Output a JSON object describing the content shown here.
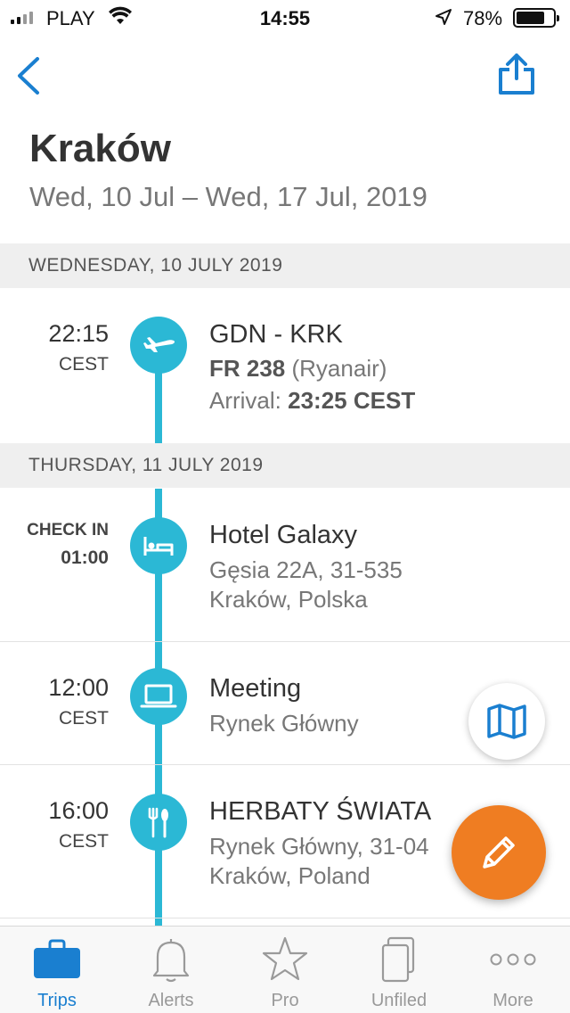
{
  "status_bar": {
    "carrier": "PLAY",
    "time": "14:55",
    "battery": "78%",
    "battery_level": 0.78
  },
  "trip": {
    "title": "Kraków",
    "dates": "Wed, 10 Jul – Wed, 17 Jul, 2019"
  },
  "days": [
    {
      "header": "WEDNESDAY, 10 JULY 2019",
      "items": [
        {
          "time": "22:15",
          "time_sub": "CEST",
          "icon": "plane-icon",
          "title": "GDN - KRK",
          "flight_number": "FR 238",
          "airline": "(Ryanair)",
          "arrival_label": "Arrival:",
          "arrival_time": "23:25 CEST"
        }
      ]
    },
    {
      "header": "THURSDAY, 11 JULY 2019",
      "items": [
        {
          "time_label": "CHECK IN",
          "time": "01:00",
          "icon": "bed-icon",
          "title": "Hotel Galaxy",
          "line1": "Gęsia 22A, 31-535",
          "line2": "Kraków, Polska"
        },
        {
          "time": "12:00",
          "time_sub": "CEST",
          "icon": "laptop-icon",
          "title": "Meeting",
          "line1": "Rynek Główny"
        },
        {
          "time": "16:00",
          "time_sub": "CEST",
          "icon": "fork-spoon-icon",
          "title": "HERBATY ŚWIATA",
          "line1": "Rynek Główny, 31-04",
          "line2": "Kraków, Poland"
        }
      ]
    }
  ],
  "tabs": [
    {
      "label": "Trips",
      "icon": "briefcase-icon",
      "active": true
    },
    {
      "label": "Alerts",
      "icon": "bell-icon"
    },
    {
      "label": "Pro",
      "icon": "star-icon"
    },
    {
      "label": "Unfiled",
      "icon": "documents-icon"
    },
    {
      "label": "More",
      "icon": "ellipsis-icon"
    }
  ],
  "colors": {
    "accent": "#2bb8d5",
    "link": "#1a7fd0",
    "fab": "#ef7d22"
  }
}
